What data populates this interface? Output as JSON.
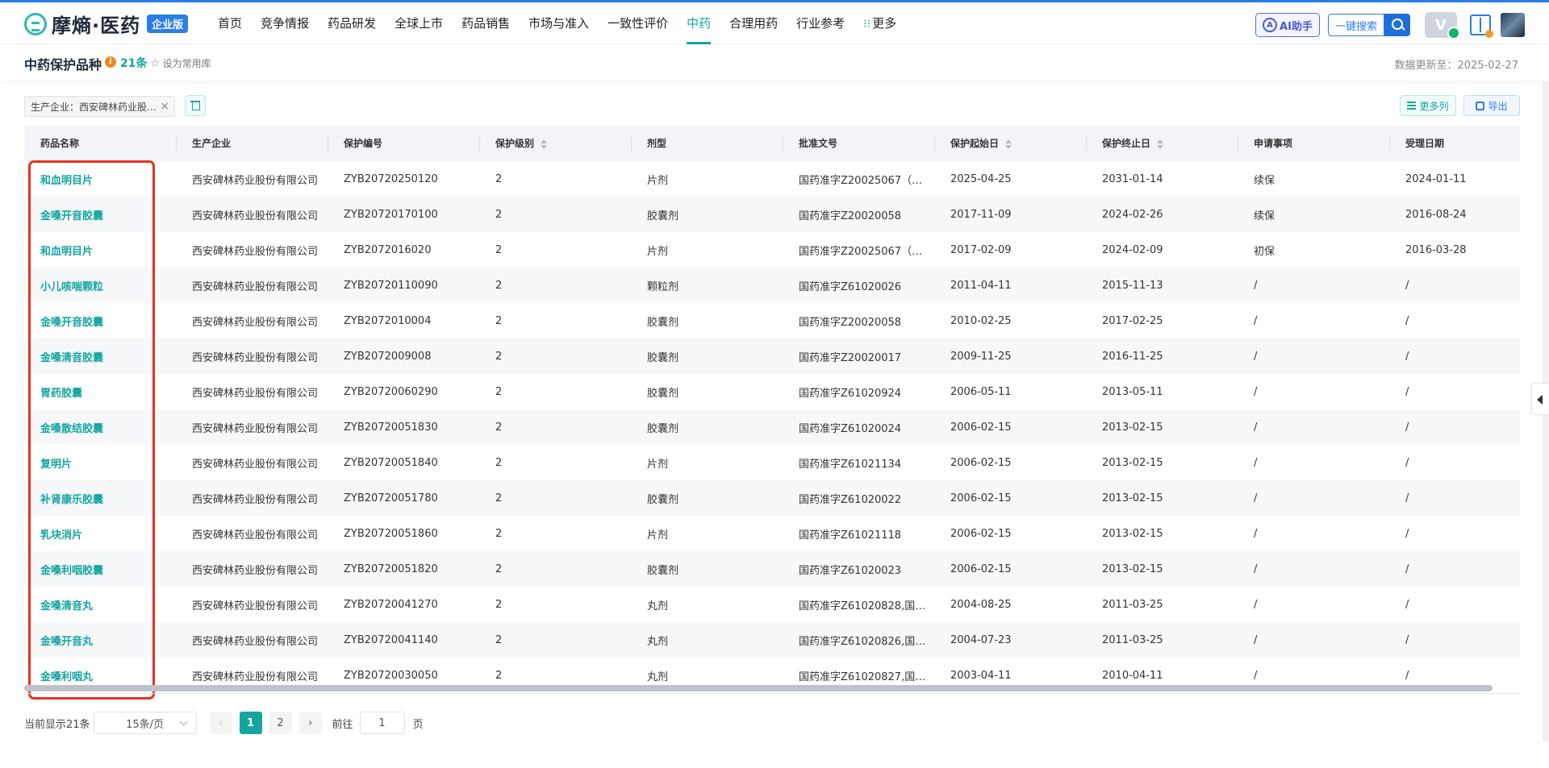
{
  "brand": {
    "name": "摩熵·医药",
    "badge": "企业版"
  },
  "nav": [
    "首页",
    "竞争情报",
    "药品研发",
    "全球上市",
    "药品销售",
    "市场与准入",
    "一致性评价",
    "中药",
    "合理用药",
    "行业参考",
    "更多"
  ],
  "nav_active_index": 7,
  "header_right": {
    "ai_label": "AI助手",
    "search_label": "一键搜索",
    "vip_label": "V"
  },
  "page": {
    "title": "中药保护品种",
    "count": "21条",
    "fav_label": "设为常用库",
    "update_text": "数据更新至：2025-02-27"
  },
  "filters": {
    "chip": "生产企业：西安碑林药业股份有限公司",
    "more_cols": "更多列",
    "export": "导出"
  },
  "table": {
    "columns": [
      "药品名称",
      "生产企业",
      "保护编号",
      "保护级别",
      "剂型",
      "批准文号",
      "保护起始日",
      "保护终止日",
      "申请事项",
      "受理日期"
    ],
    "sortable": [
      false,
      false,
      false,
      true,
      false,
      false,
      true,
      true,
      false,
      false
    ],
    "rows": [
      [
        "和血明目片",
        "西安碑林药业股份有限公司",
        "ZYB20720250120",
        "2",
        "片剂",
        "国药准字Z20025067（…",
        "2025-04-25",
        "2031-01-14",
        "续保",
        "2024-01-11"
      ],
      [
        "金嗓开音胶囊",
        "西安碑林药业股份有限公司",
        "ZYB20720170100",
        "2",
        "胶囊剂",
        "国药准字Z20020058",
        "2017-11-09",
        "2024-02-26",
        "续保",
        "2016-08-24"
      ],
      [
        "和血明目片",
        "西安碑林药业股份有限公司",
        "ZYB2072016020",
        "2",
        "片剂",
        "国药准字Z20025067（…",
        "2017-02-09",
        "2024-02-09",
        "初保",
        "2016-03-28"
      ],
      [
        "小儿咳喘颗粒",
        "西安碑林药业股份有限公司",
        "ZYB20720110090",
        "2",
        "颗粒剂",
        "国药准字Z61020026",
        "2011-04-11",
        "2015-11-13",
        "/",
        "/"
      ],
      [
        "金嗓开音胶囊",
        "西安碑林药业股份有限公司",
        "ZYB2072010004",
        "2",
        "胶囊剂",
        "国药准字Z20020058",
        "2010-02-25",
        "2017-02-25",
        "/",
        "/"
      ],
      [
        "金嗓清音胶囊",
        "西安碑林药业股份有限公司",
        "ZYB2072009008",
        "2",
        "胶囊剂",
        "国药准字Z20020017",
        "2009-11-25",
        "2016-11-25",
        "/",
        "/"
      ],
      [
        "胃药胶囊",
        "西安碑林药业股份有限公司",
        "ZYB20720060290",
        "2",
        "胶囊剂",
        "国药准字Z61020924",
        "2006-05-11",
        "2013-05-11",
        "/",
        "/"
      ],
      [
        "金嗓散结胶囊",
        "西安碑林药业股份有限公司",
        "ZYB20720051830",
        "2",
        "胶囊剂",
        "国药准字Z61020024",
        "2006-02-15",
        "2013-02-15",
        "/",
        "/"
      ],
      [
        "复明片",
        "西安碑林药业股份有限公司",
        "ZYB20720051840",
        "2",
        "片剂",
        "国药准字Z61021134",
        "2006-02-15",
        "2013-02-15",
        "/",
        "/"
      ],
      [
        "补肾康乐胶囊",
        "西安碑林药业股份有限公司",
        "ZYB20720051780",
        "2",
        "胶囊剂",
        "国药准字Z61020022",
        "2006-02-15",
        "2013-02-15",
        "/",
        "/"
      ],
      [
        "乳块消片",
        "西安碑林药业股份有限公司",
        "ZYB20720051860",
        "2",
        "片剂",
        "国药准字Z61021118",
        "2006-02-15",
        "2013-02-15",
        "/",
        "/"
      ],
      [
        "金嗓利咽胶囊",
        "西安碑林药业股份有限公司",
        "ZYB20720051820",
        "2",
        "胶囊剂",
        "国药准字Z61020023",
        "2006-02-15",
        "2013-02-15",
        "/",
        "/"
      ],
      [
        "金嗓清音丸",
        "西安碑林药业股份有限公司",
        "ZYB20720041270",
        "2",
        "丸剂",
        "国药准字Z61020828,国…",
        "2004-08-25",
        "2011-03-25",
        "/",
        "/"
      ],
      [
        "金嗓开音丸",
        "西安碑林药业股份有限公司",
        "ZYB20720041140",
        "2",
        "丸剂",
        "国药准字Z61020826,国…",
        "2004-07-23",
        "2011-03-25",
        "/",
        "/"
      ],
      [
        "金嗓利咽丸",
        "西安碑林药业股份有限公司",
        "ZYB20720030050",
        "2",
        "丸剂",
        "国药准字Z61020827,国…",
        "2003-04-11",
        "2010-04-11",
        "/",
        "/"
      ]
    ]
  },
  "pagination": {
    "total_text": "当前显示21条",
    "page_size": "15条/页",
    "pages": [
      "1",
      "2"
    ],
    "current": "1",
    "goto_label": "前往",
    "goto_value": "1",
    "page_unit": "页"
  },
  "colors": {
    "accent": "#15a5a0",
    "brand_blue": "#2b7de9",
    "highlight": "#e8321f"
  }
}
